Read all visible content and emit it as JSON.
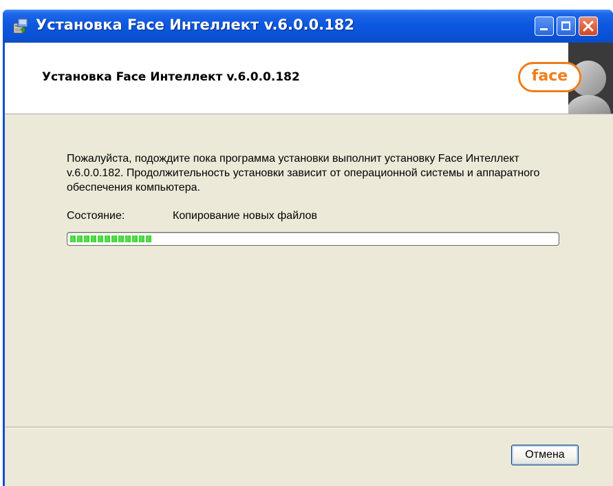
{
  "window": {
    "title": "Установка Face Интеллект v.6.0.0.182",
    "controls": {
      "minimize": "minimize",
      "maximize": "maximize",
      "close": "close"
    }
  },
  "banner": {
    "title": "Установка Face Интеллект v.6.0.0.182",
    "logo_text": "face"
  },
  "main": {
    "description": "Пожалуйста, подождите пока программа установки выполнит установку Face Интеллект v.6.0.0.182. Продолжительность установки зависит от операционной системы и аппаратного обеспечения компьютера.",
    "status_label": "Состояние:",
    "status_value": "Копирование новых файлов",
    "progress_fraction": 0.17
  },
  "footer": {
    "cancel_label": "Отмена"
  },
  "colors": {
    "titlebar": "#0a52d6",
    "dialog_bg": "#ece9d8",
    "progress_green": "#37d12f",
    "logo_orange": "#f07d1a"
  },
  "icons": [
    "installer-icon",
    "minimize-icon",
    "maximize-icon",
    "close-icon",
    "face-logo",
    "user-silhouette-icon"
  ]
}
